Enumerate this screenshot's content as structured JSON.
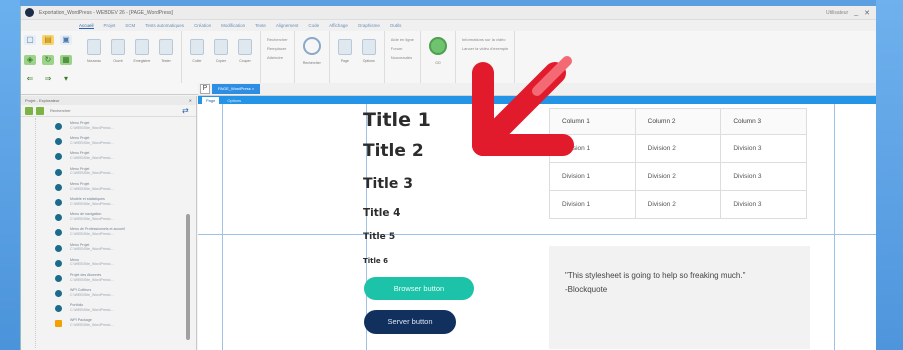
{
  "window": {
    "title": "Exportation_WordPress - WEBDEV 26 - [PAGE_WordPress]",
    "user_label": "Utilisateur",
    "minimize": "_",
    "close": "✕"
  },
  "menubar": {
    "items": [
      "Accueil",
      "Projet",
      "SCM",
      "Tests automatiques",
      "Création",
      "Modification",
      "Texte",
      "Alignement",
      "Code",
      "Affichage",
      "Graphisme",
      "Outils"
    ]
  },
  "ribbon": {
    "groups": [
      {
        "buttons": [
          "Nouveau",
          "Ouvrir",
          "Enregistrer",
          "Tester"
        ]
      },
      {
        "buttons": [
          "Coller",
          "Copier",
          "Couper"
        ]
      },
      {
        "list": [
          "Rechercher",
          "Remplacer",
          "Atteindre"
        ]
      },
      {
        "buttons": [
          "Rechercher"
        ]
      },
      {
        "buttons": [
          "Page",
          "Options"
        ]
      },
      {
        "list": [
          "Aide en ligne",
          "Forum",
          "Nouveautés"
        ]
      },
      {
        "big": "GO"
      },
      {
        "list": [
          "Informations sur la vidéo",
          "Lancer la vidéo d'exemple"
        ]
      }
    ]
  },
  "explorer": {
    "title": "Projet - Explorateur",
    "close": "✕",
    "search_placeholder": "Rechercher",
    "items": [
      {
        "name": "Menu Projet",
        "sub": "C:\\WEB\\Site_WordPress\\..."
      },
      {
        "name": "Menu Projet",
        "sub": "C:\\WEB\\Site_WordPress\\..."
      },
      {
        "name": "Menu Projet",
        "sub": "C:\\WEB\\Site_WordPress\\..."
      },
      {
        "name": "Menu Projet",
        "sub": "C:\\WEB\\Site_WordPress\\..."
      },
      {
        "name": "Menu Projet",
        "sub": "C:\\WEB\\Site_WordPress\\..."
      },
      {
        "name": "Modèle et statistiques",
        "sub": "C:\\WEB\\Site_WordPress\\..."
      },
      {
        "name": "Menu de navigation",
        "sub": "C:\\WEB\\Site_WordPress\\..."
      },
      {
        "name": "Menu de Professionnels et accueil",
        "sub": "C:\\WEB\\Site_WordPress\\..."
      },
      {
        "name": "Menu Projet",
        "sub": "C:\\WEB\\Site_WordPress\\..."
      },
      {
        "name": "Menu",
        "sub": "C:\\WEB\\Site_WordPress\\..."
      },
      {
        "name": "Projet des Abonnés",
        "sub": "C:\\WEB\\Site_WordPress\\..."
      },
      {
        "name": "WPI Coffeurs",
        "sub": "C:\\WEB\\Site_WordPress\\..."
      },
      {
        "name": "Portfolio",
        "sub": "C:\\WEB\\Site_WordPress\\..."
      },
      {
        "name": "WPI Package",
        "sub": "C:\\WEB\\Site_WordPress\\..."
      }
    ]
  },
  "editor": {
    "doc_tab": "PAGE_WordPress",
    "doc_tab_close": "×",
    "p_tab": "P",
    "views": [
      "Page",
      "Options"
    ],
    "headings": [
      "Title 1",
      "Title 2",
      "Title 3",
      "Title 4",
      "Title 5",
      "Title 6"
    ],
    "browser_button": "Browser button",
    "server_button": "Server button",
    "table": {
      "headers": [
        "Column 1",
        "Column 2",
        "Column 3"
      ],
      "rows": [
        [
          "Division 1",
          "Division 2",
          "Division 3"
        ],
        [
          "Division 1",
          "Division 2",
          "Division 3"
        ],
        [
          "Division 1",
          "Division 2",
          "Division 3"
        ]
      ]
    },
    "blockquote": {
      "text": "\"This stylesheet is going to help so freaking much.\"",
      "author": "-Blockquote"
    }
  },
  "colors": {
    "accent": "#2394e6",
    "browser_button": "#1cc3a8",
    "server_button": "#12305e",
    "arrow": "#e21b2c"
  }
}
